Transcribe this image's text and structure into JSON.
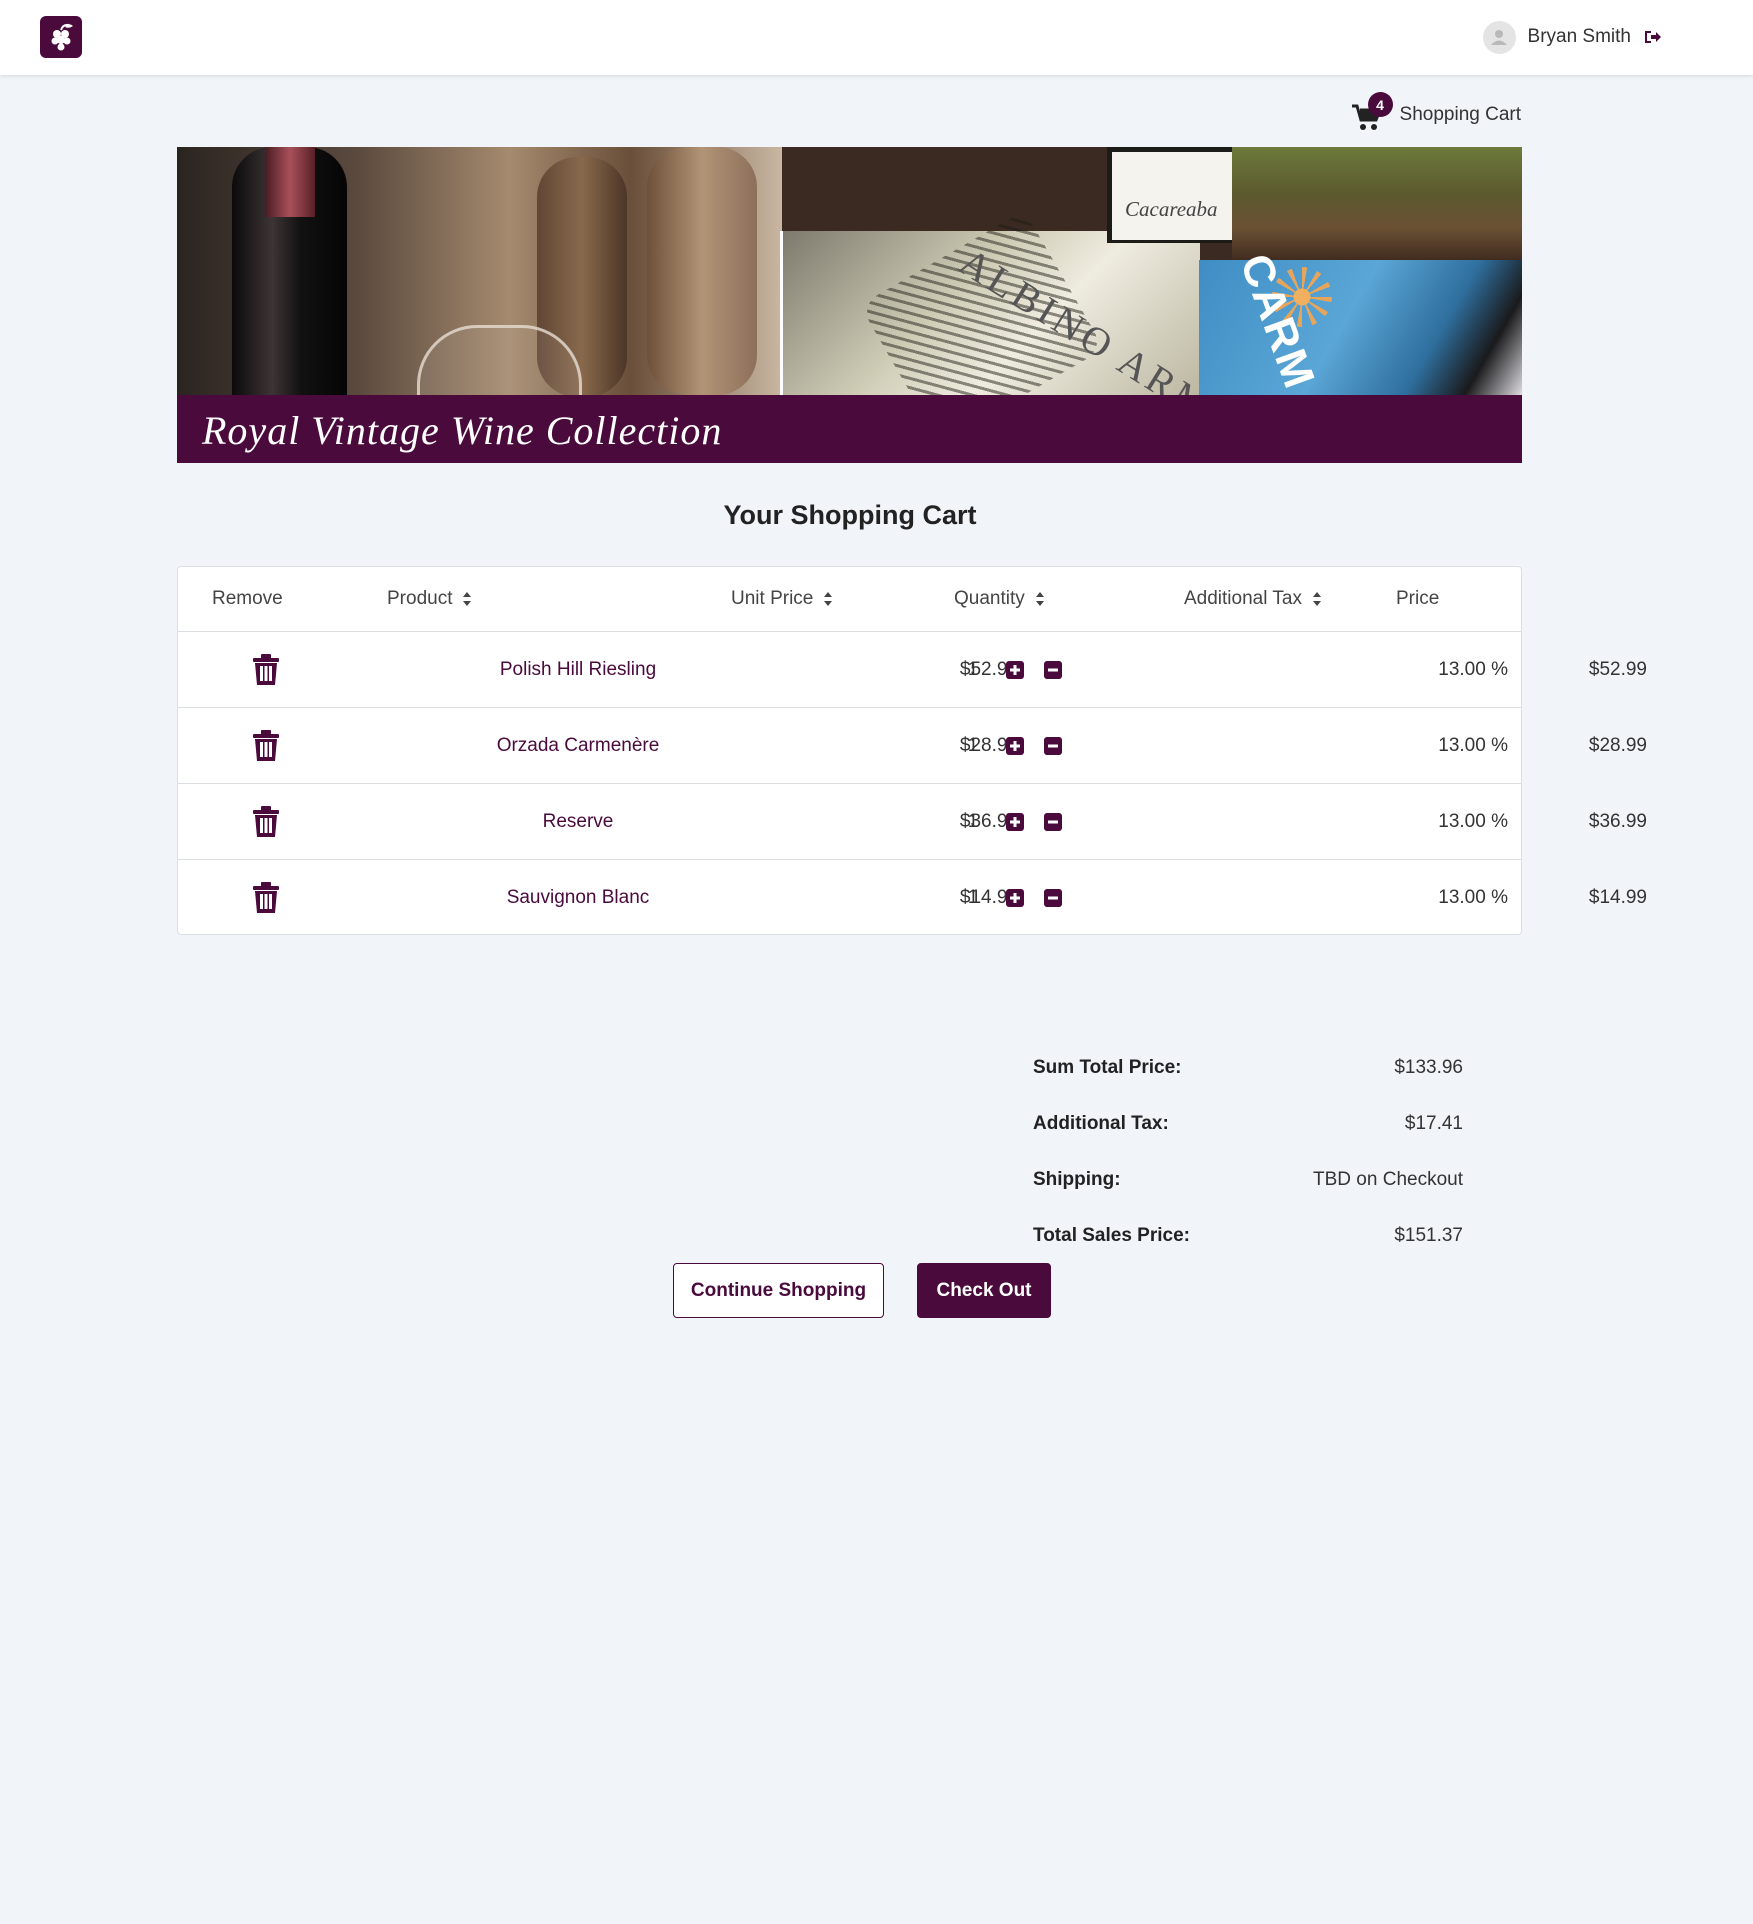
{
  "header": {
    "user_name": "Bryan Smith"
  },
  "cart_link": {
    "count": "4",
    "label": "Shopping Cart"
  },
  "banner": {
    "title": "Royal Vintage Wine Collection",
    "bottle_label": "Cacareaba",
    "label_text": "ALBINO ARMAS",
    "blue_label": "CARM"
  },
  "page": {
    "title": "Your Shopping Cart"
  },
  "table": {
    "headers": {
      "remove": "Remove",
      "product": "Product",
      "unit_price": "Unit Price",
      "quantity": "Quantity",
      "additional_tax": "Additional Tax",
      "price": "Price"
    },
    "rows": [
      {
        "product": "Polish Hill Riesling",
        "unit_price": "$52.99",
        "quantity": "1",
        "tax": "13.00 %",
        "price": "$52.99"
      },
      {
        "product": "Orzada Carmenère",
        "unit_price": "$28.99",
        "quantity": "1",
        "tax": "13.00 %",
        "price": "$28.99"
      },
      {
        "product": "Reserve",
        "unit_price": "$36.99",
        "quantity": "1",
        "tax": "13.00 %",
        "price": "$36.99"
      },
      {
        "product": "Sauvignon Blanc",
        "unit_price": "$14.99",
        "quantity": "1",
        "tax": "13.00 %",
        "price": "$14.99"
      }
    ]
  },
  "summary": {
    "sum_total_label": "Sum Total Price:",
    "sum_total_value": "$133.96",
    "tax_label": "Additional Tax:",
    "tax_value": "$17.41",
    "shipping_label": "Shipping:",
    "shipping_value": "TBD on Checkout",
    "total_label": "Total Sales Price:",
    "total_value": "$151.37"
  },
  "buttons": {
    "continue": "Continue Shopping",
    "checkout": "Check Out"
  },
  "colors": {
    "brand": "#4a0a3c",
    "background": "#f1f4f8"
  },
  "icons": {
    "logo": "grapes-icon",
    "avatar": "user-icon",
    "logout": "sign-out-icon",
    "cart": "shopping-cart-icon",
    "sort": "sort-icon",
    "remove": "trash-icon",
    "increase": "plus-square-icon",
    "decrease": "minus-square-icon"
  }
}
